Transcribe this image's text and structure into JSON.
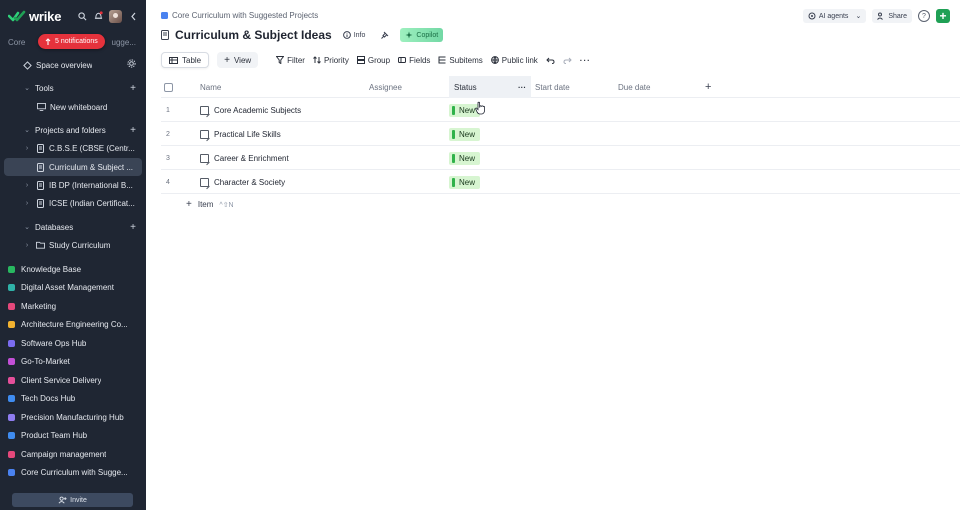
{
  "app": {
    "logo_text": "wrike"
  },
  "sidebar": {
    "workspace_label_left": "Core",
    "workspace_label_right": "ugge...",
    "notifications_label": "5 notifications",
    "items": [
      {
        "label": "Space overview"
      },
      {
        "label": "Tools"
      },
      {
        "label": "New whiteboard"
      },
      {
        "label": "Projects and folders"
      },
      {
        "label": "C.B.S.E (CBSE (Centr..."
      },
      {
        "label": "Curriculum & Subject ..."
      },
      {
        "label": "IB DP (International B..."
      },
      {
        "label": "ICSE (Indian Certificat..."
      },
      {
        "label": "Databases"
      },
      {
        "label": "Study Curriculum"
      }
    ],
    "spaces": [
      {
        "label": "Knowledge Base",
        "color": "#28b860"
      },
      {
        "label": "Digital Asset Management",
        "color": "#2fb2a8"
      },
      {
        "label": "Marketing",
        "color": "#e5487b"
      },
      {
        "label": "Architecture Engineering Co...",
        "color": "#f2b230"
      },
      {
        "label": "Software Ops Hub",
        "color": "#7b6cf0"
      },
      {
        "label": "Go-To-Market",
        "color": "#c24fd6"
      },
      {
        "label": "Client Service Delivery",
        "color": "#e54f9a"
      },
      {
        "label": "Tech Docs Hub",
        "color": "#3f8cf0"
      },
      {
        "label": "Precision Manufacturing Hub",
        "color": "#8f7df0"
      },
      {
        "label": "Product Team Hub",
        "color": "#3f8cf0"
      },
      {
        "label": "Campaign management",
        "color": "#e5487b"
      },
      {
        "label": "Core Curriculum with Sugge...",
        "color": "#4a82f0"
      }
    ],
    "invite_label": "Invite"
  },
  "header": {
    "breadcrumb": "Core Curriculum with Suggested Projects",
    "title": "Curriculum & Subject Ideas",
    "info_label": "Info",
    "copilot_label": "Copilot",
    "ai_agents_label": "AI agents",
    "share_label": "Share",
    "help_label": "?"
  },
  "toolbar": {
    "table_label": "Table",
    "view_label": "View",
    "filter_label": "Filter",
    "priority_label": "Priority",
    "group_label": "Group",
    "fields_label": "Fields",
    "subitems_label": "Subitems",
    "public_link_label": "Public link"
  },
  "table": {
    "columns": [
      "Name",
      "Assignee",
      "Status",
      "Start date",
      "Due date"
    ],
    "rows": [
      {
        "num": "1",
        "name": "Core Academic Subjects",
        "status": "New"
      },
      {
        "num": "2",
        "name": "Practical Life Skills",
        "status": "New"
      },
      {
        "num": "3",
        "name": "Career & Enrichment",
        "status": "New"
      },
      {
        "num": "4",
        "name": "Character & Society",
        "status": "New"
      }
    ],
    "add_item_label": "Item",
    "add_item_shortcut": "^⇧N"
  }
}
